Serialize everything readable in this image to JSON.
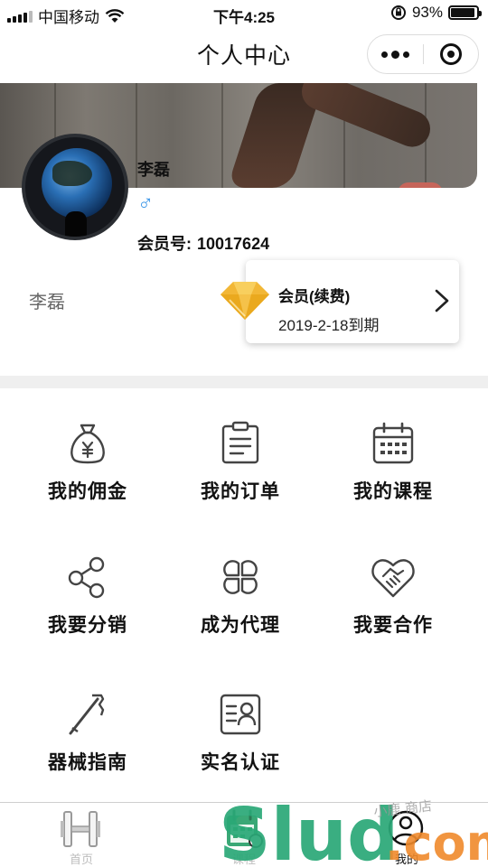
{
  "status_bar": {
    "carrier": "中国移动",
    "time": "下午4:25",
    "battery": "93%",
    "battery_level": 0.93
  },
  "nav": {
    "title": "个人中心"
  },
  "profile": {
    "name": "李磊",
    "gender_symbol": "♂",
    "member_label": "会员号:",
    "member_number": "10017624",
    "display_name": "李磊"
  },
  "membership": {
    "title": "会员(续费)",
    "expiry": "2019-2-18到期"
  },
  "menu": [
    {
      "label": "我的佣金",
      "icon": "money-bag-icon"
    },
    {
      "label": "我的订单",
      "icon": "clipboard-icon"
    },
    {
      "label": "我的课程",
      "icon": "calendar-icon"
    },
    {
      "label": "我要分销",
      "icon": "share-nodes-icon"
    },
    {
      "label": "成为代理",
      "icon": "four-petals-icon"
    },
    {
      "label": "我要合作",
      "icon": "handshake-icon"
    },
    {
      "label": "器械指南",
      "icon": "trekking-pole-icon"
    },
    {
      "label": "实名认证",
      "icon": "id-card-icon"
    }
  ],
  "tabs": [
    {
      "label": "首页",
      "icon": "dumbbell-icon",
      "active": false
    },
    {
      "label": "课程",
      "icon": "calendar-icon",
      "active": false
    },
    {
      "label": "我的",
      "icon": "user-icon",
      "active": true
    }
  ],
  "watermark": {
    "brand": "Slud.com",
    "script_text": "小鹿 商店"
  }
}
